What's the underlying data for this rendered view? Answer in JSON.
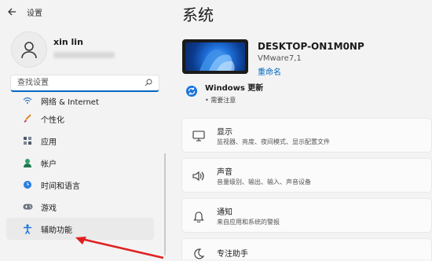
{
  "window": {
    "app_title": "设置",
    "back_icon": "back-arrow-icon"
  },
  "profile": {
    "name": "xin lin"
  },
  "search": {
    "placeholder": "查找设置"
  },
  "nav": {
    "items": [
      {
        "label": "网络 & Internet",
        "icon": "network-icon"
      },
      {
        "label": "个性化",
        "icon": "brush-icon"
      },
      {
        "label": "应用",
        "icon": "apps-icon"
      },
      {
        "label": "帐户",
        "icon": "account-icon"
      },
      {
        "label": "时间和语言",
        "icon": "time-language-icon"
      },
      {
        "label": "游戏",
        "icon": "gamepad-icon"
      },
      {
        "label": "辅助功能",
        "icon": "accessibility-icon",
        "selected": true
      }
    ]
  },
  "main": {
    "title": "系统",
    "device": {
      "name": "DESKTOP-ON1M0NP",
      "model": "VMware7,1",
      "rename_label": "重命名"
    },
    "update": {
      "title": "Windows 更新",
      "subtitle": "• 需要注意"
    },
    "cards": [
      {
        "title": "显示",
        "subtitle": "监视器、亮度、夜间模式、显示配置文件",
        "icon": "display-icon"
      },
      {
        "title": "声音",
        "subtitle": "音量级别、输出、输入、声音设备",
        "icon": "speaker-icon"
      },
      {
        "title": "通知",
        "subtitle": "来自应用和系统的警报",
        "icon": "bell-icon"
      },
      {
        "title": "专注助手",
        "subtitle": "",
        "icon": "moon-icon"
      }
    ]
  },
  "colors": {
    "accent": "#0067c0",
    "annotation_arrow": "#e02020"
  }
}
